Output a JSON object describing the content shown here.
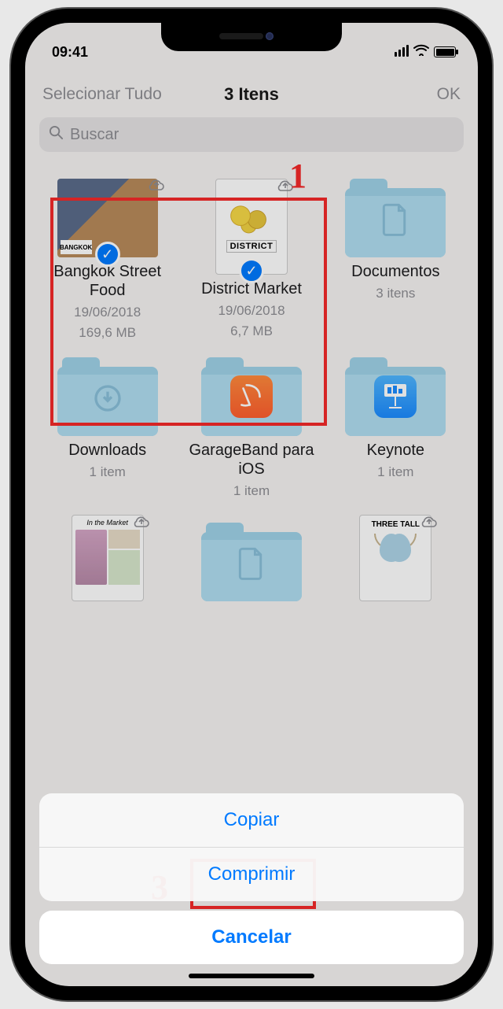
{
  "status": {
    "time": "09:41"
  },
  "nav": {
    "select_all": "Selecionar Tudo",
    "title": "3 Itens",
    "done": "OK"
  },
  "search": {
    "placeholder": "Buscar"
  },
  "annotations": {
    "a1": "1",
    "a3": "3"
  },
  "items": [
    {
      "title": "Bangkok Street Food",
      "date": "19/06/2018",
      "size": "169,6 MB",
      "selected": true,
      "cloud": true
    },
    {
      "title": "District Market",
      "date": "19/06/2018",
      "size": "6,7 MB",
      "selected": true,
      "cloud": true
    },
    {
      "title": "Documentos",
      "meta": "3 itens",
      "folder": true
    },
    {
      "title": "Downloads",
      "meta": "1 item",
      "folder": true
    },
    {
      "title": "GarageBand para iOS",
      "meta": "1 item",
      "folder": true,
      "app": "garageband"
    },
    {
      "title": "Keynote",
      "meta": "1 item",
      "folder": true,
      "app": "keynote"
    },
    {
      "title": "In the Market",
      "cloud": true,
      "thumb": "market-book"
    },
    {
      "title": "",
      "folder": true,
      "partial": true
    },
    {
      "title": "THREE TALL",
      "cloud": true,
      "thumb": "threetall"
    }
  ],
  "sheet": {
    "copy": "Copiar",
    "compress": "Comprimir",
    "cancel": "Cancelar"
  },
  "thumb_labels": {
    "district": "DISTRICT",
    "bangkok": "BANGKOK",
    "inmarket": "In the Market",
    "threetall": "THREE TALL"
  }
}
